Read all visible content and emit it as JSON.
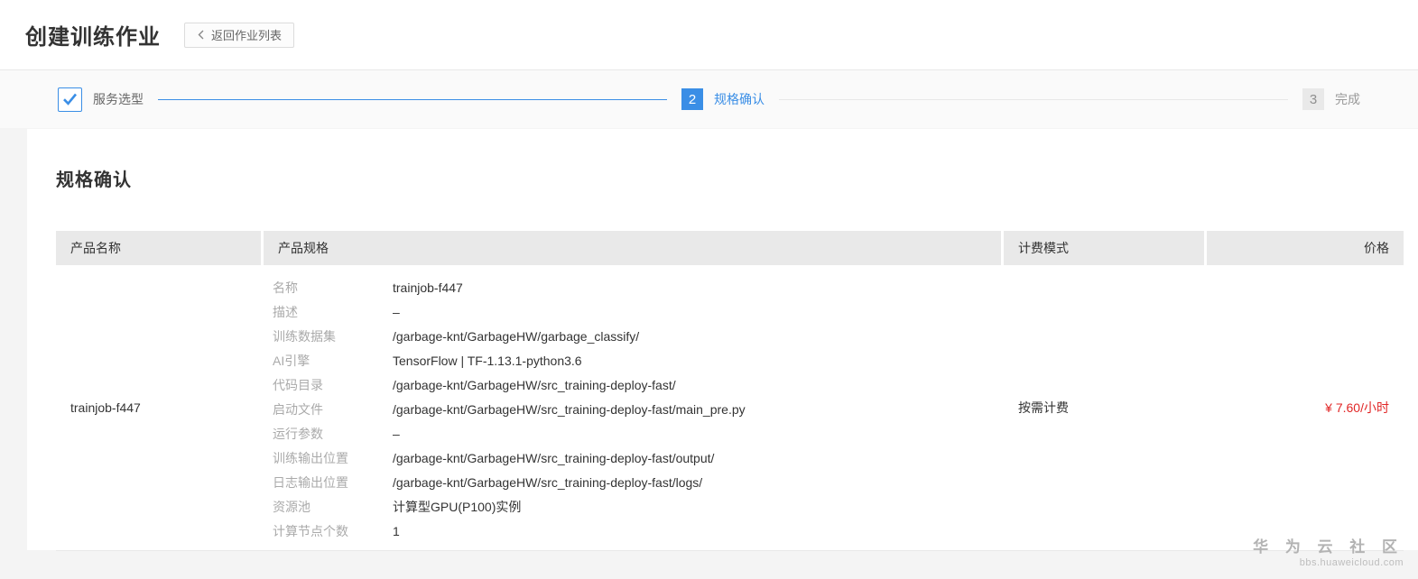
{
  "page": {
    "title": "创建训练作业",
    "back_button_label": "返回作业列表"
  },
  "stepper": {
    "steps": [
      {
        "number": "1",
        "label": "服务选型",
        "state": "done"
      },
      {
        "number": "2",
        "label": "规格确认",
        "state": "active"
      },
      {
        "number": "3",
        "label": "完成",
        "state": "pending"
      }
    ]
  },
  "section": {
    "title": "规格确认"
  },
  "table": {
    "headers": [
      "产品名称",
      "产品规格",
      "计费模式",
      "价格"
    ],
    "row": {
      "product_name": "trainjob-f447",
      "billing_mode": "按需计费",
      "price": "¥ 7.60/小时",
      "specs": [
        {
          "label": "名称",
          "value": "trainjob-f447"
        },
        {
          "label": "描述",
          "value": "–"
        },
        {
          "label": "训练数据集",
          "value": "/garbage-knt/GarbageHW/garbage_classify/"
        },
        {
          "label": "AI引擎",
          "value": "TensorFlow | TF-1.13.1-python3.6"
        },
        {
          "label": "代码目录",
          "value": "/garbage-knt/GarbageHW/src_training-deploy-fast/"
        },
        {
          "label": "启动文件",
          "value": "/garbage-knt/GarbageHW/src_training-deploy-fast/main_pre.py"
        },
        {
          "label": "运行参数",
          "value": "–"
        },
        {
          "label": "训练输出位置",
          "value": "/garbage-knt/GarbageHW/src_training-deploy-fast/output/"
        },
        {
          "label": "日志输出位置",
          "value": "/garbage-knt/GarbageHW/src_training-deploy-fast/logs/"
        },
        {
          "label": "资源池",
          "value": "计算型GPU(P100)实例"
        },
        {
          "label": "计算节点个数",
          "value": "1"
        }
      ]
    }
  },
  "watermark": {
    "line1": "华 为 云 社 区",
    "line2": "bbs.huaweicloud.com"
  },
  "colors": {
    "accent_blue": "#3a8ee6",
    "price_red": "#e12626",
    "header_gray": "#e9e9e9"
  }
}
